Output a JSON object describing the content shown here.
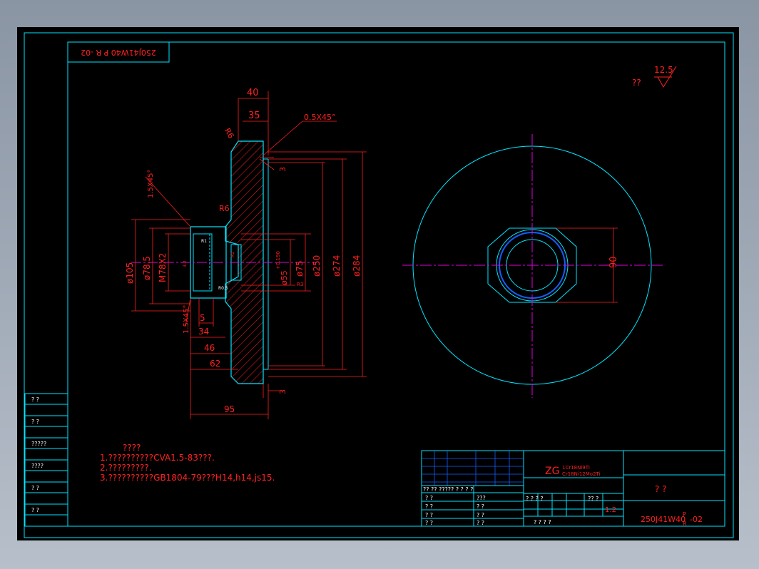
{
  "title_block_mirrored": "250J41W40 P R -02",
  "roughness": {
    "label": "??",
    "value": "12.5"
  },
  "dims": {
    "d40": "40",
    "d35": "35",
    "chamfer_top": "0.5X45°",
    "r6a": "R6",
    "r6b": "R6",
    "chamfer_left": "1.5X45°",
    "chamfer_bottom": "1.5X45°",
    "d105": "ø105",
    "d78": "ø78.5",
    "m78": "M78X2",
    "d55": "ø55",
    "d55tol": "+0.190",
    "d75": "ø75",
    "d250": "ø250",
    "d274": "ø274",
    "d284": "ø284",
    "d5": "5",
    "d34": "34",
    "d46": "46",
    "d62": "62",
    "d95": "95",
    "d3top": "3",
    "d3bot": "3",
    "d90": "90",
    "r1": "R1",
    "r05": "R0.5",
    "r1b": "R1",
    "r3": "R3",
    "r3b": "3.2"
  },
  "notes": {
    "heading": "????",
    "line1": "1.??????????CVA1.5-83???.",
    "line2": "2.?????????.",
    "line3": "3.??????????GB1804-79???H14,h14,js15."
  },
  "left_stamps": [
    "?  ?",
    "?  ?",
    "?????",
    "????",
    "?  ?",
    "?  ?"
  ],
  "title_block": {
    "material_main": "ZG",
    "material_1": "1Cr18Ni9Ti",
    "material_2": "Cr18Ni12Mo2Ti",
    "part_name": "?   ?",
    "scale": "1:2",
    "drawing_no": "250J41W40",
    "drawing_suffix": "-02",
    "drawing_p": "P",
    "drawing_r": "R",
    "row_labels": [
      "??  ??  ?????   ? ?  ? ?",
      "? ?",
      "? ?",
      "? ?",
      "? ?"
    ],
    "mid_labels": [
      "???",
      "? ?",
      "? ?",
      "? ?"
    ],
    "header_right": "? ? ? ?",
    "header_qq": "??   ?",
    "footer": "?       ?        ?       ?"
  },
  "colors": {
    "frame": "#00e5ff",
    "dim": "#ff2020",
    "center": "#e000e0",
    "part": "#00e5ff",
    "hatch": "#ff2020"
  }
}
